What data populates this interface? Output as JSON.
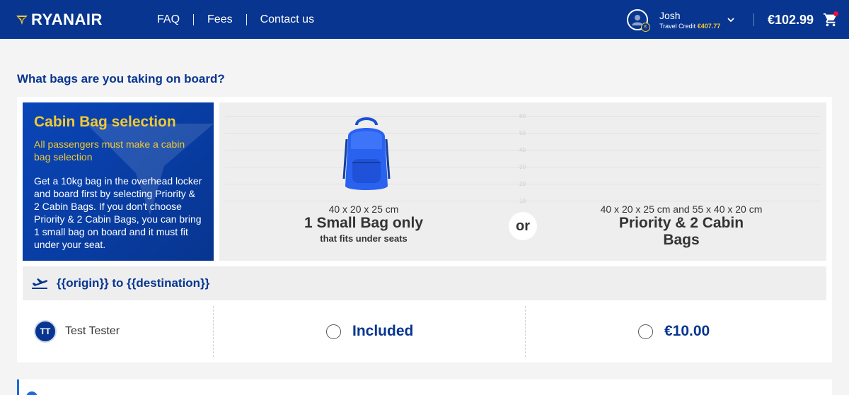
{
  "header": {
    "brand": "RYANAIR",
    "nav": [
      "FAQ",
      "Fees",
      "Contact us"
    ],
    "user": {
      "name": "Josh",
      "credit_label": "Travel Credit",
      "credit_amount": "€407.77"
    },
    "total": "€102.99"
  },
  "page": {
    "title": "What bags are you taking on board?"
  },
  "promo": {
    "title": "Cabin Bag selection",
    "subtitle": "All passengers must make a cabin bag selection",
    "body": "Get a 10kg bag in the overhead locker and board first by selecting Priority & 2 Cabin Bags. If you don't choose Priority & 2 Cabin Bags, you can bring 1 small bag on board and it must fit under your seat."
  },
  "compare": {
    "scale_labels": [
      "60",
      "50",
      "40",
      "30",
      "20",
      "10"
    ],
    "small": {
      "dimensions": "40 x 20 x 25 cm",
      "title": "1 Small Bag only",
      "note": "that fits under seats"
    },
    "or_label": "or",
    "priority": {
      "dimensions": "40 x 20 x 25 cm and 55 x 40 x 20 cm",
      "title": "Priority & 2 Cabin Bags"
    }
  },
  "route": {
    "text": "{{origin}} to {{destination}}"
  },
  "passenger": {
    "initials": "TT",
    "name": "Test Tester",
    "option_included": "Included",
    "option_price": "€10.00"
  },
  "colors": {
    "brand_blue": "#073590",
    "brand_yellow": "#f1c933",
    "info_blue": "#1b6bd8"
  }
}
